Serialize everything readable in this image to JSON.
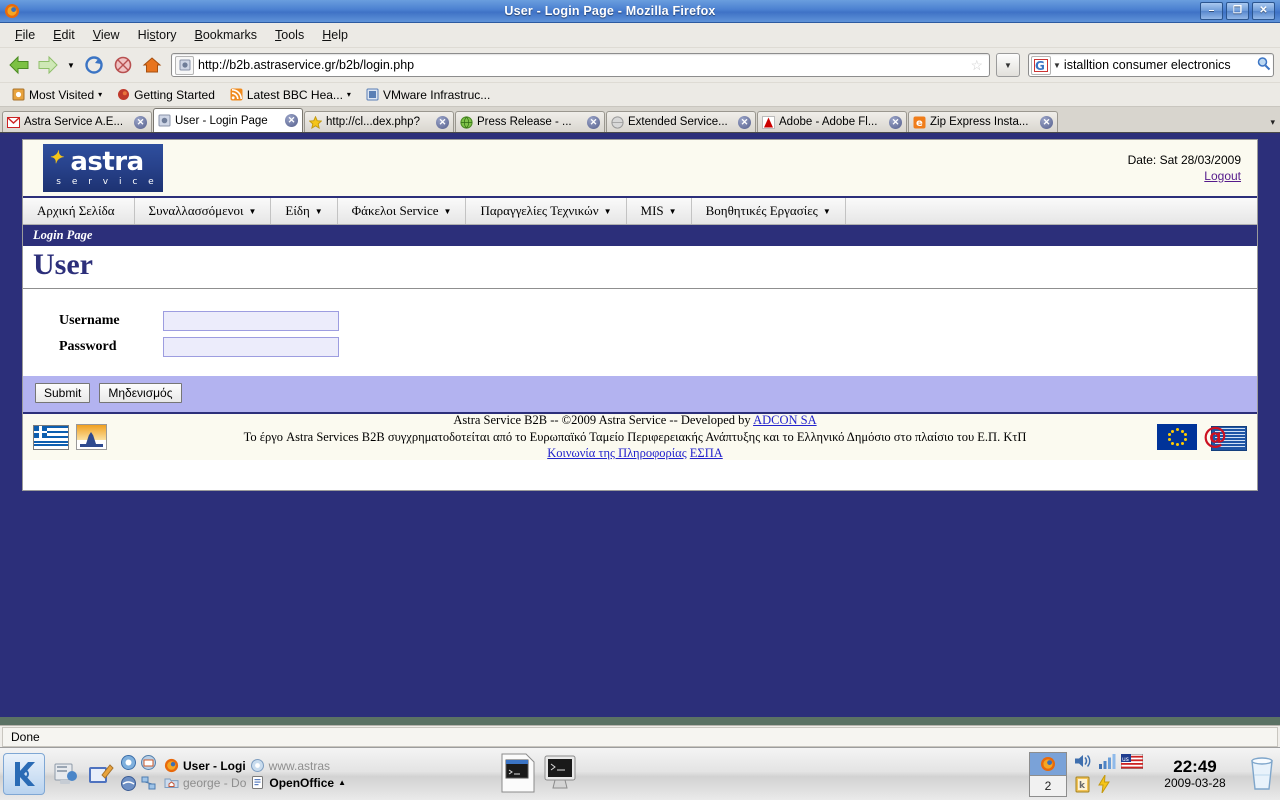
{
  "window": {
    "title": "User - Login Page - Mozilla Firefox",
    "app_icon": "firefox-icon",
    "minimize_label": "–",
    "restore_label": "❐",
    "close_label": "✕"
  },
  "menubar": {
    "items": [
      {
        "label": "File",
        "accel": "F"
      },
      {
        "label": "Edit",
        "accel": "E"
      },
      {
        "label": "View",
        "accel": "V"
      },
      {
        "label": "History",
        "accel": "s"
      },
      {
        "label": "Bookmarks",
        "accel": "B"
      },
      {
        "label": "Tools",
        "accel": "T"
      },
      {
        "label": "Help",
        "accel": "H"
      }
    ]
  },
  "navbar": {
    "back_icon": "back-arrow-icon",
    "forward_icon": "forward-arrow-icon",
    "history_caret": "▾",
    "reload_icon": "reload-icon",
    "stop_icon": "stop-icon",
    "home_icon": "home-icon",
    "url": "http://b2b.astraservice.gr/b2b/login.php",
    "url_favicon": "page-favicon",
    "bookmark_star": "☆",
    "url_dropdown_caret": "▼",
    "search_engine": "G",
    "search_engine_caret": "▼",
    "search_value": "istalltion consumer electronics",
    "search_icon": "magnifier-icon"
  },
  "bookmarks": {
    "items": [
      {
        "label": "Most Visited",
        "icon": "most-visited-icon",
        "caret": "▾"
      },
      {
        "label": "Getting Started",
        "icon": "firefox-getting-started-icon",
        "caret": ""
      },
      {
        "label": "Latest BBC Hea...",
        "icon": "rss-feed-icon",
        "caret": "▾"
      },
      {
        "label": "VMware Infrastruc...",
        "icon": "vmware-icon",
        "caret": ""
      }
    ]
  },
  "tabs": {
    "items": [
      {
        "label": "Astra Service A.E...",
        "icon": "gmail-icon",
        "active": false
      },
      {
        "label": "User - Login Page",
        "icon": "page-favicon",
        "active": true
      },
      {
        "label": "http://cl...dex.php?",
        "icon": "star-icon",
        "active": false
      },
      {
        "label": "Press Release - ...",
        "icon": "globe-icon",
        "active": false
      },
      {
        "label": "Extended Service...",
        "icon": "grey-globe-icon",
        "active": false
      },
      {
        "label": "Adobe - Adobe Fl...",
        "icon": "adobe-icon",
        "active": false
      },
      {
        "label": "Zip Express Insta...",
        "icon": "zip-express-icon",
        "active": false
      }
    ],
    "close_label": "✕",
    "list_all_caret": "▾"
  },
  "site": {
    "logo": {
      "name": "astra",
      "tagline": "s e r v i c e",
      "spark": "✦"
    },
    "header": {
      "date_label": "Date: Sat 28/03/2009",
      "logout_label": "Logout"
    },
    "nav": [
      {
        "label": "Αρχική Σελίδα",
        "caret": ""
      },
      {
        "label": "Συναλλασσόμενοι",
        "caret": "▼"
      },
      {
        "label": "Είδη",
        "caret": "▼"
      },
      {
        "label": "Φάκελοι Service",
        "caret": "▼"
      },
      {
        "label": "Παραγγελίες Τεχνικών",
        "caret": "▼"
      },
      {
        "label": "MIS",
        "caret": "▼"
      },
      {
        "label": "Βοηθητικές Εργασίες",
        "caret": "▼"
      }
    ],
    "breadcrumb": "Login Page",
    "page_title": "User",
    "form": {
      "username_label": "Username",
      "username_value": "",
      "password_label": "Password",
      "password_value": "",
      "submit_label": "Submit",
      "reset_label": "Μηδενισμός"
    },
    "footer": {
      "line1_pre": "Astra Service B2B -- ©2009 Astra Service -- Developed by ",
      "line1_link": "ADCON SA",
      "line2": "Το έργο Astra Services B2B συγχρηματοδοτείται από το Ευρωπαϊκό Ταμείο Περιφερειακής Ανάπτυξης και το Ελληνικό Δημόσιο στο πλαίσιο του Ε.Π. ΚτΠ",
      "link_kp": "Κοινωνία της Πληροφορίας",
      "link_espa": "ΕΣΠΑ",
      "greek_flag_icon": "greek-flag-icon",
      "espa_icon": "espa-logo-icon",
      "eu_flag_icon": "eu-flag-icon",
      "kp_icon": "information-society-logo-icon"
    }
  },
  "status": {
    "text": "Done"
  },
  "taskbar": {
    "kmenu_icon": "kde-menu-icon",
    "launchers": [
      {
        "icon": "show-desktop-icon"
      },
      {
        "icon": "text-editor-icon"
      }
    ],
    "quick_icons": [
      {
        "icon": "konqueror-icon"
      },
      {
        "icon": "kmail-icon"
      },
      {
        "icon": "browser-globe-icon"
      },
      {
        "icon": "network-icon"
      }
    ],
    "tasks": [
      {
        "label": "User - Logi",
        "icon": "firefox-icon",
        "active": true
      },
      {
        "label": "www.astras",
        "icon": "konqueror-icon",
        "active": false
      },
      {
        "label": "george - Do",
        "icon": "folder-icon",
        "active": false
      },
      {
        "label": "OpenOffice",
        "icon": "openoffice-icon",
        "active": false,
        "caret": "▲"
      }
    ],
    "window_thumbs": [
      {
        "icon": "terminal-window-icon"
      },
      {
        "icon": "terminal-desktop-icon"
      }
    ],
    "pager": {
      "current_icon": "firefox-icon",
      "desktop_number": "2"
    },
    "tray": [
      {
        "icon": "volume-icon"
      },
      {
        "icon": "signal-bars-icon"
      },
      {
        "icon": "us-keyboard-flag-icon"
      },
      {
        "icon": "klipper-icon"
      },
      {
        "icon": "power-icon"
      }
    ],
    "clock": {
      "time": "22:49",
      "date": "2009-03-28"
    },
    "trash_icon": "trash-bin-icon"
  }
}
